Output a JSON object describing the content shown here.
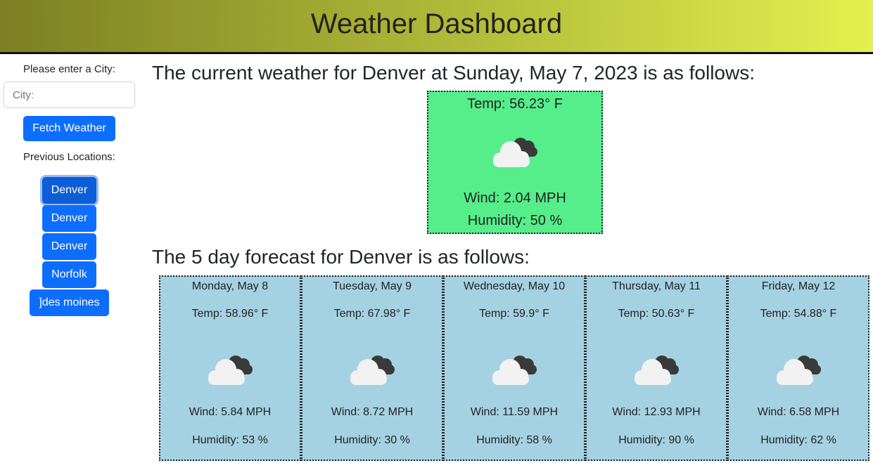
{
  "header": {
    "title": "Weather Dashboard"
  },
  "sidebar": {
    "city_label": "Please enter a City:",
    "city_input": {
      "placeholder": "City:",
      "value": ""
    },
    "fetch_button": "Fetch Weather",
    "previous_label": "Previous Locations:",
    "locations": [
      "Denver",
      "Denver",
      "Denver",
      "Norfolk",
      "]des moines"
    ],
    "active_location_index": 0
  },
  "current": {
    "heading": "The current weather for Denver at Sunday, May 7, 2023 is as follows:",
    "temp": "Temp: 56.23° F",
    "icon": "broken-clouds-icon",
    "wind": "Wind: 2.04 MPH",
    "humidity": "Humidity: 50 %",
    "card_color": "#55ee8b"
  },
  "forecast": {
    "heading": "The 5 day forecast for Denver is as follows:",
    "card_color": "#a5d2e2",
    "days": [
      {
        "date": "Monday, May 8",
        "temp": "Temp: 58.96° F",
        "icon": "broken-clouds-icon",
        "wind": "Wind: 5.84 MPH",
        "humidity": "Humidity: 53 %"
      },
      {
        "date": "Tuesday, May 9",
        "temp": "Temp: 67.98° F",
        "icon": "broken-clouds-icon",
        "wind": "Wind: 8.72 MPH",
        "humidity": "Humidity: 30 %"
      },
      {
        "date": "Wednesday, May 10",
        "temp": "Temp: 59.9° F",
        "icon": "broken-clouds-icon",
        "wind": "Wind: 11.59 MPH",
        "humidity": "Humidity: 58 %"
      },
      {
        "date": "Thursday, May 11",
        "temp": "Temp: 50.63° F",
        "icon": "broken-clouds-icon",
        "wind": "Wind: 12.93 MPH",
        "humidity": "Humidity: 90 %"
      },
      {
        "date": "Friday, May 12",
        "temp": "Temp: 54.88° F",
        "icon": "broken-clouds-icon",
        "wind": "Wind: 6.58 MPH",
        "humidity": "Humidity: 62 %"
      }
    ]
  },
  "colors": {
    "accent": "#0d6efd",
    "header_gradient": [
      "#7d7f22",
      "#e4f04e"
    ]
  }
}
